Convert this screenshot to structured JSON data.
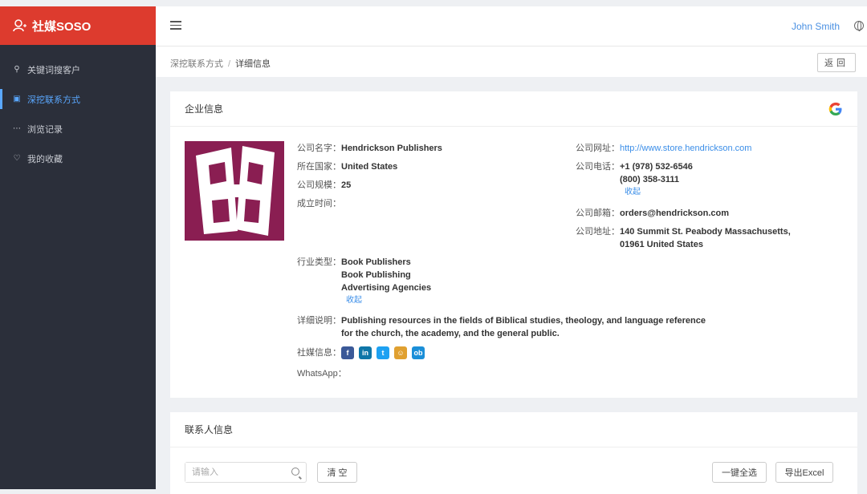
{
  "sidebar": {
    "brand": "社媒SOSO",
    "items": [
      {
        "label": "关键词搜客户",
        "active": false
      },
      {
        "label": "深挖联系方式",
        "active": true
      },
      {
        "label": "浏览记录",
        "active": false
      },
      {
        "label": "我的收藏",
        "active": false
      }
    ]
  },
  "topbar": {
    "user": "John Smith"
  },
  "breadcrumb": {
    "parent": "深挖联系方式",
    "sep": "/",
    "current": "详细信息"
  },
  "back_label": "返回",
  "company": {
    "section_title": "企业信息",
    "name_label": "公司名字：",
    "name": "Hendrickson Publishers",
    "country_label": "所在国家：",
    "country": "United States",
    "size_label": "公司规模：",
    "size": "25",
    "founded_label": "成立时间：",
    "founded": "",
    "website_label": "公司网址：",
    "website": "http://www.store.hendrickson.com",
    "phone_label": "公司电话：",
    "phones": [
      "+1 (978) 532-6546",
      "(800) 358-3111"
    ],
    "phone_collapse": "收起",
    "email_label": "公司邮箱：",
    "email": "orders@hendrickson.com",
    "address_label": "公司地址：",
    "address_lines": [
      "140 Summit St. Peabody Massachusetts,",
      "01961 United States"
    ],
    "industry_label": "行业类型：",
    "industries": [
      "Book Publishers",
      "Book Publishing",
      "Advertising Agencies"
    ],
    "industry_collapse": "收起",
    "desc_label": "详细说明：",
    "desc_lines": [
      "Publishing resources in the fields of Biblical studies, theology, and language reference",
      "for the church, the academy, and the general public."
    ],
    "social_label": "社媒信息：",
    "social": [
      {
        "icon": "facebook-icon",
        "glyph": "f",
        "color": "#3b5998"
      },
      {
        "icon": "linkedin-icon",
        "glyph": "in",
        "color": "#0e76a8"
      },
      {
        "icon": "twitter-icon",
        "glyph": "t",
        "color": "#1da1f2"
      },
      {
        "icon": "avatar-icon",
        "glyph": "☺",
        "color": "#e0a030"
      },
      {
        "icon": "ob-icon",
        "glyph": "ob",
        "color": "#1b8fd8"
      }
    ],
    "whatsapp_label": "WhatsApp："
  },
  "contacts": {
    "section_title": "联系人信息",
    "search_placeholder": "请输入",
    "clear_label": "清 空",
    "select_all_label": "一键全选",
    "export_label": "导出Excel"
  }
}
